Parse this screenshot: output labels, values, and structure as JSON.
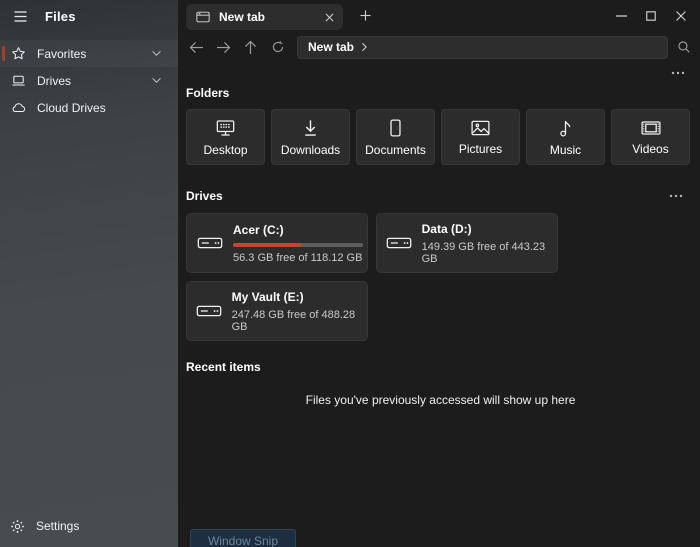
{
  "app": {
    "title": "Files"
  },
  "colors": {
    "accent_red": "#a63e2e",
    "progress_red": "#bf4736",
    "progress_track": "#5d5d5d"
  },
  "sidebar": {
    "items": [
      {
        "label": "Favorites",
        "icon": "star",
        "expandable": true,
        "active": true
      },
      {
        "label": "Drives",
        "icon": "laptop",
        "expandable": true,
        "active": false
      },
      {
        "label": "Cloud Drives",
        "icon": "cloud",
        "expandable": false,
        "active": false
      }
    ],
    "settings_label": "Settings"
  },
  "titlebar": {
    "tab_title": "New tab",
    "window_controls": [
      "minimize",
      "maximize",
      "close"
    ]
  },
  "navbar": {
    "breadcrumb": "New tab"
  },
  "sections": {
    "folders": {
      "heading": "Folders",
      "items": [
        {
          "label": "Desktop",
          "icon": "monitor"
        },
        {
          "label": "Downloads",
          "icon": "download-arrow"
        },
        {
          "label": "Documents",
          "icon": "document"
        },
        {
          "label": "Pictures",
          "icon": "picture"
        },
        {
          "label": "Music",
          "icon": "music-note"
        },
        {
          "label": "Videos",
          "icon": "film"
        }
      ]
    },
    "drives": {
      "heading": "Drives",
      "items": [
        {
          "name": "Acer (C:)",
          "free": "56.3 GB free of 118.12 GB",
          "used_percent": 52,
          "show_bar": true
        },
        {
          "name": "Data (D:)",
          "free": "149.39 GB free of 443.23 GB",
          "show_bar": false
        },
        {
          "name": "My Vault (E:)",
          "free": "247.48 GB free of 488.28 GB",
          "show_bar": false
        }
      ]
    },
    "recent": {
      "heading": "Recent items",
      "empty_text": "Files you've previously accessed will show up here"
    }
  },
  "overlay": {
    "window_snip_label": "Window Snip"
  }
}
